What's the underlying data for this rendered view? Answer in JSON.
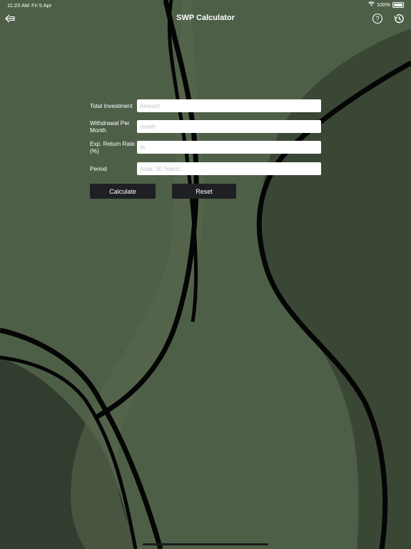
{
  "status": {
    "time": "11:23 AM",
    "date": "Fri 5 Apr",
    "battery": "100%"
  },
  "nav": {
    "title": "SWP Calculator"
  },
  "form": {
    "fields": [
      {
        "label": "Total Investment",
        "placeholder": "Amount",
        "value": ""
      },
      {
        "label": "Withdrawal Per Month",
        "placeholder": "month",
        "value": ""
      },
      {
        "label": "Exp. Return Rate (%)",
        "placeholder": "%",
        "value": ""
      },
      {
        "label": "Period",
        "placeholder": "(max: 50 Years)",
        "value": ""
      }
    ],
    "calculate_label": "Calculate",
    "reset_label": "Reset"
  },
  "colors": {
    "background_light": "#4e5f47",
    "background_dark": "#3b4735",
    "stroke": "#050505",
    "button": "#1f2023"
  },
  "icons": {
    "back": "back-arrow-icon",
    "help": "question-circle-icon",
    "history": "history-clock-icon",
    "wifi": "wifi-icon",
    "battery": "battery-icon"
  }
}
